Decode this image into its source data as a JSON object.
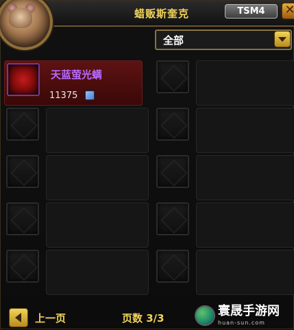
{
  "header": {
    "vendor_name": "蜡贩斯奎克",
    "addon_badge": "TSM4",
    "close_icon": "close-icon"
  },
  "filter": {
    "selected": "全部",
    "icon": "chevron-down-icon"
  },
  "items": [
    {
      "name": "天蓝萤光螨",
      "price": "11375",
      "currency_icon": "coin-icon",
      "rarity_color": "#b66bff"
    },
    {
      "name": "",
      "price": ""
    },
    {
      "name": "",
      "price": ""
    },
    {
      "name": "",
      "price": ""
    },
    {
      "name": "",
      "price": ""
    },
    {
      "name": "",
      "price": ""
    },
    {
      "name": "",
      "price": ""
    },
    {
      "name": "",
      "price": ""
    },
    {
      "name": "",
      "price": ""
    },
    {
      "name": "",
      "price": ""
    }
  ],
  "pagination": {
    "prev_label": "上一页",
    "page_info": "页数 3/3",
    "prev_icon": "chevron-left-icon"
  },
  "watermark": {
    "title": "寰晟手游网",
    "subtitle": "huan-sun.com"
  },
  "colors": {
    "accent_gold": "#f2d45a",
    "item_epic": "#b66bff",
    "selected_slot": "#5e1212"
  }
}
